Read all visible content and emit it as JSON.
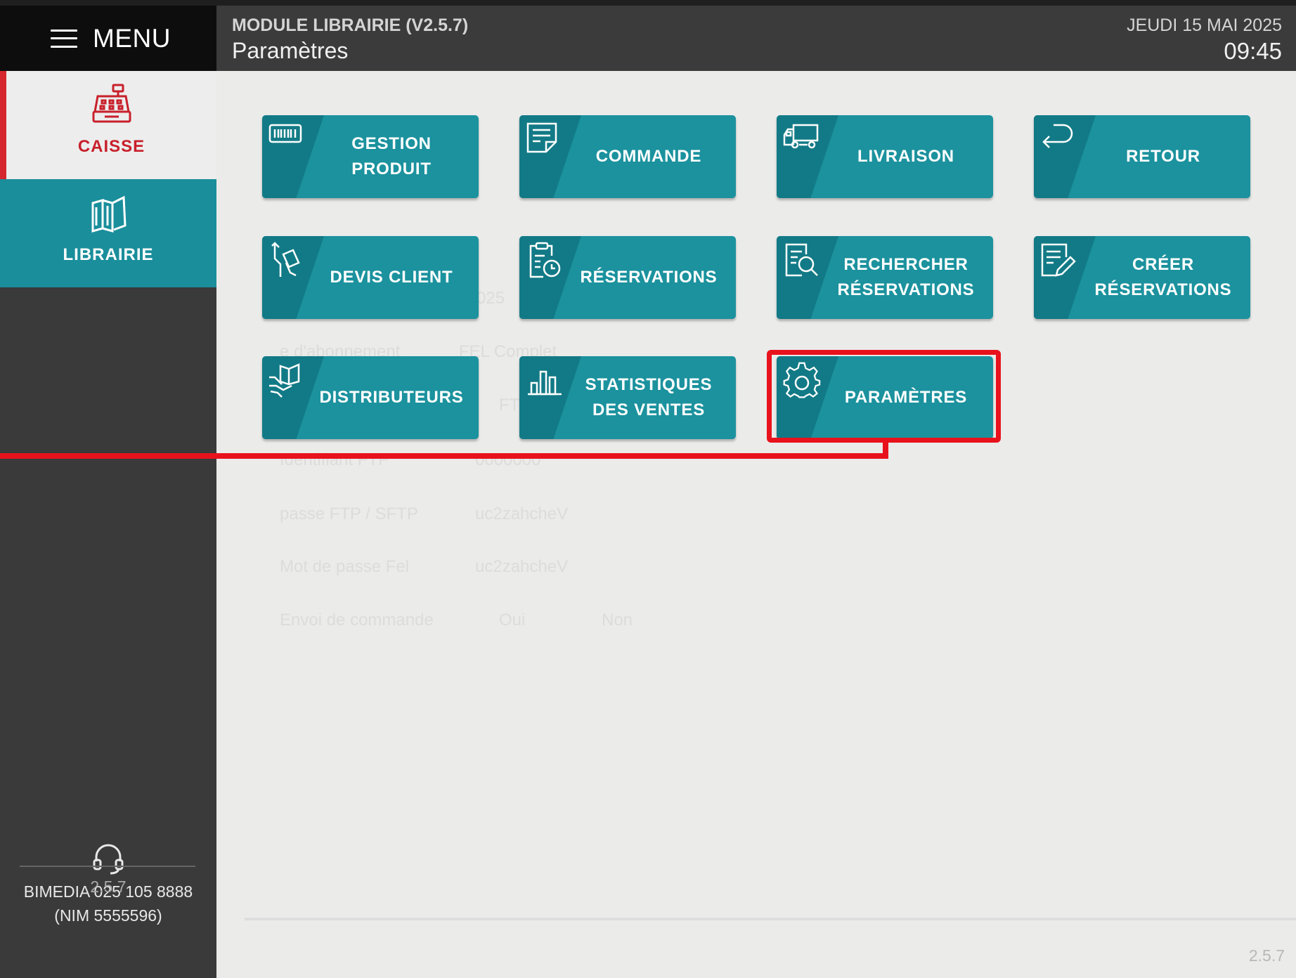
{
  "header": {
    "menu_label": "MENU",
    "module_title": "MODULE LIBRAIRIE (V2.5.7)",
    "page_title": "Paramètres",
    "date": "JEUDI 15 MAI 2025",
    "time": "09:45"
  },
  "sidebar": {
    "items": [
      {
        "label": "CAISSE",
        "icon": "cash-register-icon"
      },
      {
        "label": "LIBRAIRIE",
        "icon": "books-icon"
      }
    ],
    "support_line1": "BIMEDIA 025 105 8888",
    "support_line2": "(NIM 5555596)",
    "version": "2.5.7"
  },
  "tiles": [
    {
      "line1": "GESTION",
      "line2": "PRODUIT",
      "icon": "barcode-icon"
    },
    {
      "line1": "COMMANDE",
      "line2": "",
      "icon": "note-icon"
    },
    {
      "line1": "LIVRAISON",
      "line2": "",
      "icon": "truck-icon"
    },
    {
      "line1": "RETOUR",
      "line2": "",
      "icon": "return-arrow-icon"
    },
    {
      "line1": "DEVIS CLIENT",
      "line2": "",
      "icon": "hand-card-icon"
    },
    {
      "line1": "RÉSERVATIONS",
      "line2": "",
      "icon": "clipboard-clock-icon"
    },
    {
      "line1": "RECHERCHER",
      "line2": "RÉSERVATIONS",
      "icon": "document-search-icon"
    },
    {
      "line1": "CRÉER",
      "line2": "RÉSERVATIONS",
      "icon": "document-pen-icon"
    },
    {
      "line1": "DISTRIBUTEURS",
      "line2": "",
      "icon": "hand-book-icon"
    },
    {
      "line1": "STATISTIQUES",
      "line2": "DES VENTES",
      "icon": "bar-chart-icon"
    },
    {
      "line1": "PARAMÈTRES",
      "line2": "",
      "icon": "gear-icon"
    }
  ],
  "background_form": {
    "row1_value": "025",
    "row2_label": "e d'abonnement",
    "row2_value": "FEL Complet",
    "row3_value": "FT",
    "row4_label": "Identifiant FTP",
    "row4_value": "0000000",
    "row5_label": "passe FTP / SFTP",
    "row5_value": "uc2zahcheV",
    "row6_label": "Mot de passe Fel",
    "row6_value": "uc2zahcheV",
    "row7_label": "Envoi de commande",
    "row7_opt1": "Oui",
    "row7_opt2": "Non"
  },
  "main_version": "2.5.7",
  "colors": {
    "tile": "#1b929e",
    "accent": "#1a8e9b",
    "caisse_red": "#c8202b",
    "highlight": "#e8121c"
  }
}
